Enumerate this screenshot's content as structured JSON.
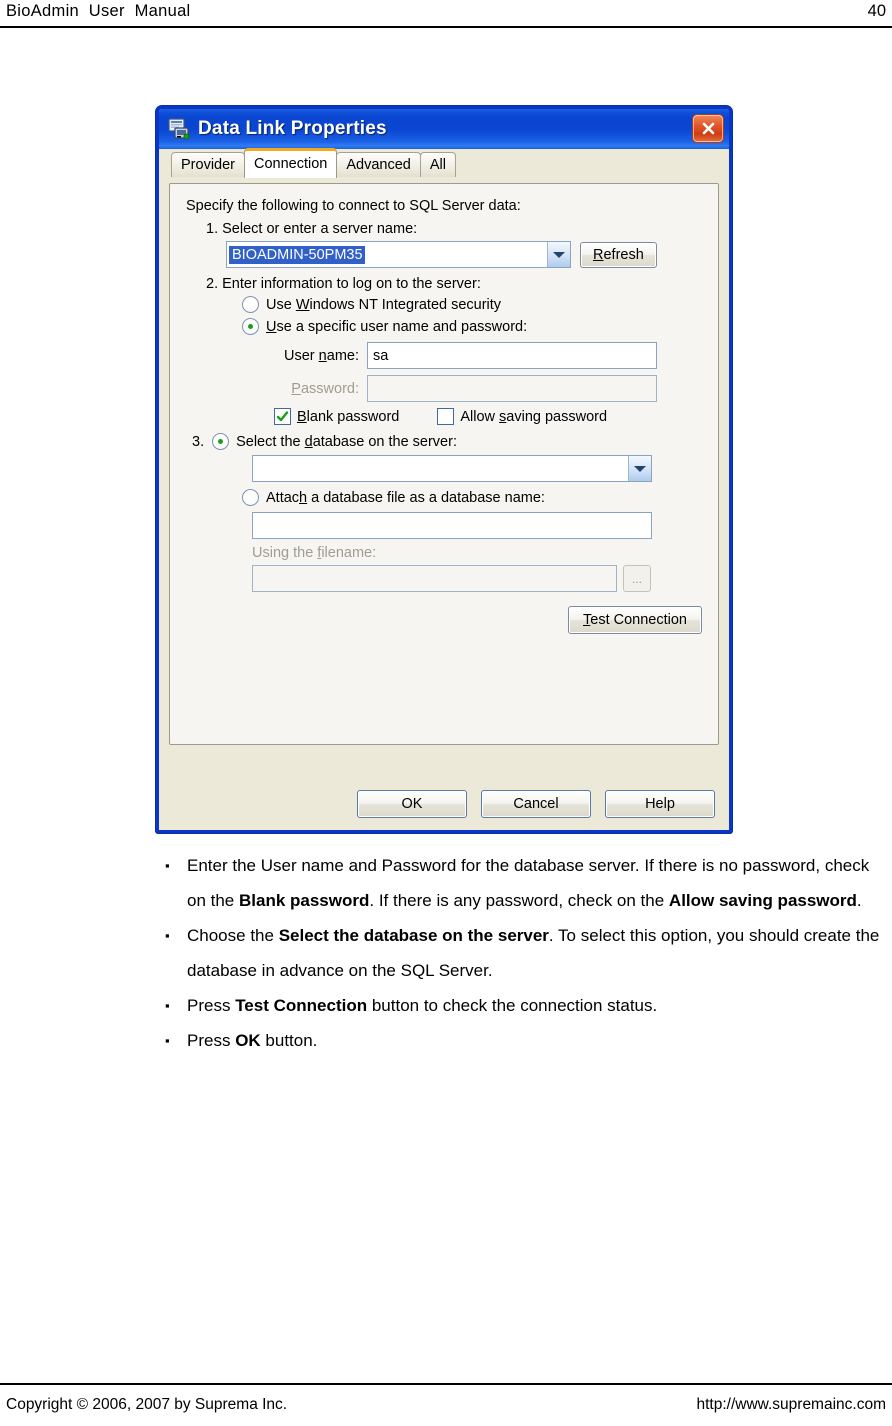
{
  "page": {
    "header_title": "BioAdmin  User  Manual",
    "header_page_number": "40",
    "footer_left": "Copyright © 2006, 2007 by Suprema Inc.",
    "footer_right": "http://www.supremainc.com"
  },
  "dialog": {
    "title": "Data Link Properties",
    "icon": "data-link-icon",
    "close_label": "×",
    "tabs": [
      {
        "label": "Provider",
        "active": false
      },
      {
        "label": "Connection",
        "active": true
      },
      {
        "label": "Advanced",
        "active": false
      },
      {
        "label": "All",
        "active": false
      }
    ],
    "panel": {
      "intro": "Specify the following to connect to SQL Server data:",
      "step1_label": "1. Select or enter a server name:",
      "server_name_value": "BIOADMIN-50PM35",
      "refresh_label": "Refresh",
      "step2_label": "2. Enter information to log on to the server:",
      "radio_windows_auth": "Use Windows NT Integrated security",
      "radio_specific_user": "Use a specific user name and password:",
      "user_name_label": "User name:",
      "user_name_value": "sa",
      "password_label": "Password:",
      "password_value": "",
      "blank_password_label": "Blank password",
      "blank_password_checked": true,
      "allow_saving_label": "Allow saving password",
      "allow_saving_checked": false,
      "step3_number": "3.",
      "radio_select_database": "Select the database on the server:",
      "database_value": "",
      "radio_attach_database": "Attach a database file as a database name:",
      "attach_database_value": "",
      "using_filename_label": "Using the filename:",
      "filename_value": "",
      "browse_label": "...",
      "test_connection_label": "Test Connection"
    },
    "buttons": {
      "ok": "OK",
      "cancel": "Cancel",
      "help": "Help"
    }
  },
  "body": {
    "bullets": [
      {
        "marker": "▪",
        "parts": [
          {
            "text": "Enter the User name and Password for the database server. If there is no password, check on the ",
            "bold": false
          },
          {
            "text": "Blank password",
            "bold": true
          },
          {
            "text": ". If there is any password, check on the ",
            "bold": false
          },
          {
            "text": "Allow saving password",
            "bold": true
          },
          {
            "text": ".",
            "bold": false
          }
        ]
      },
      {
        "marker": "▪",
        "parts": [
          {
            "text": "Choose the ",
            "bold": false
          },
          {
            "text": "Select the database on the server",
            "bold": true
          },
          {
            "text": ". To select this option, you should create the database in advance on the SQL Server.",
            "bold": false
          }
        ]
      },
      {
        "marker": "▪",
        "parts": [
          {
            "text": "Press ",
            "bold": false
          },
          {
            "text": "Test Connection",
            "bold": true
          },
          {
            "text": " button to check the connection status.",
            "bold": false
          }
        ]
      },
      {
        "marker": "▪",
        "parts": [
          {
            "text": "Press ",
            "bold": false
          },
          {
            "text": "OK",
            "bold": true
          },
          {
            "text": " button.",
            "bold": false
          }
        ]
      }
    ]
  },
  "colors": {
    "titlebar_blue": "#0a45d0",
    "dialog_border": "#0a36c8",
    "active_tab_accent": "#f5a623",
    "close_red": "#cf3c13",
    "selection_blue": "#3060c8",
    "radio_dot_green": "#17a017",
    "check_green": "#17a017"
  }
}
